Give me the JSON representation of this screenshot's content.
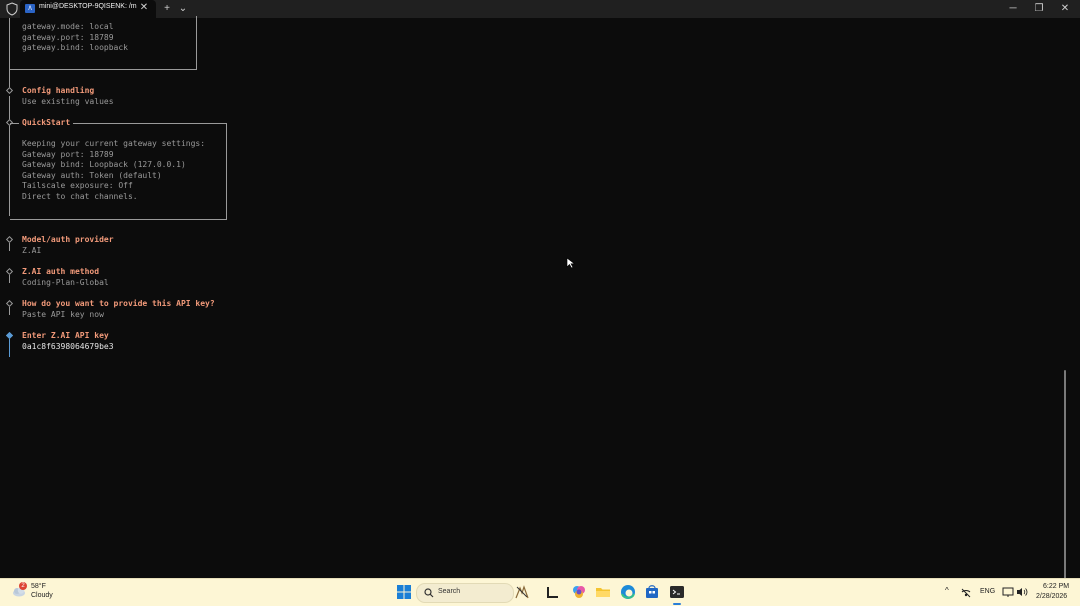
{
  "window": {
    "tab_title": "mini@DESKTOP-9QISENK: /m",
    "tab_icon_glyph": "Λ",
    "new_tab_glyph": "+",
    "dropdown_glyph": "⌄",
    "close_glyph": "✕",
    "minimize_glyph": "─",
    "maximize_glyph": "❐"
  },
  "terminal": {
    "gateway_lines": [
      "gateway.mode: local",
      "gateway.port: 18789",
      "gateway.bind: loopback"
    ],
    "config_handling": {
      "title": "Config handling",
      "value": "Use existing values"
    },
    "quickstart": {
      "title": "QuickStart",
      "lines": [
        "Keeping your current gateway settings:",
        "Gateway port: 18789",
        "Gateway bind: Loopback (127.0.0.1)",
        "Gateway auth: Token (default)",
        "Tailscale exposure: Off",
        "Direct to chat channels."
      ]
    },
    "model_provider": {
      "title": "Model/auth provider",
      "value": "Z.AI"
    },
    "auth_method": {
      "title": "Z.AI auth method",
      "value": "Coding-Plan-Global"
    },
    "api_key_method": {
      "title": "How do you want to provide this API key?",
      "value": "Paste API key now"
    },
    "api_key_entry": {
      "title": "Enter Z.AI API key",
      "value": "0a1c8f6398064679be3"
    }
  },
  "taskbar": {
    "weather": {
      "temp": "58°F",
      "condition": "Cloudy",
      "badge": "2"
    },
    "search_label": "Search",
    "tray": {
      "chevron": "^",
      "language": "ENG"
    },
    "clock": {
      "time": "6:22 PM",
      "date": "2/28/2026"
    }
  },
  "colors": {
    "terminal_bg": "#0c0c0c",
    "heading": "#f29a7a",
    "dim_text": "#9a9a9a",
    "active_step": "#5b9bd5",
    "taskbar_bg": "#fdf6d5"
  }
}
